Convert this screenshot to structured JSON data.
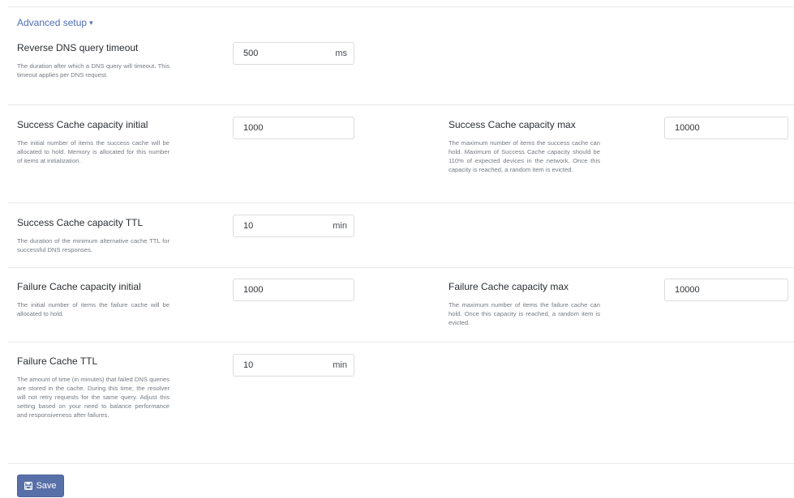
{
  "advanced_toggle": {
    "label": "Advanced setup",
    "caret": "▾"
  },
  "fields": {
    "reverse_dns_timeout": {
      "label": "Reverse DNS query timeout",
      "help": "The duration after which a DNS query will timeout. This timeout applies per DNS request.",
      "value": "500",
      "unit": "ms"
    },
    "success_cache_initial": {
      "label": "Success Cache capacity initial",
      "help": "The initial number of items the success cache will be allocated to hold. Memory is allocated for this number of items at initialization.",
      "value": "1000"
    },
    "success_cache_max": {
      "label": "Success Cache capacity max",
      "help": "The maximum number of items the success cache can hold. Maximum of Success Cache capacity should be 110% of expected devices in the network. Once this capacity is reached, a random item is evicted.",
      "value": "10000"
    },
    "success_cache_ttl": {
      "label": "Success Cache capacity TTL",
      "help": "The duration of the minimum alternative cache TTL for successful DNS responses.",
      "value": "10",
      "unit": "min"
    },
    "failure_cache_initial": {
      "label": "Failure Cache capacity initial",
      "help": "The initial number of items the failure cache will be allocated to hold.",
      "value": "1000"
    },
    "failure_cache_max": {
      "label": "Failure Cache capacity max",
      "help": "The maximum number of items the failure cache can hold. Once this capacity is reached, a random item is evicted.",
      "value": "10000"
    },
    "failure_cache_ttl": {
      "label": "Failure Cache TTL",
      "help": "The amount of time (in minutes) that failed DNS queries are stored in the cache. During this time, the resolver will not retry requests for the same query. Adjust this setting based on your need to balance performance and responsiveness after failures.",
      "value": "10",
      "unit": "min"
    }
  },
  "save_button": {
    "label": "Save",
    "icon": "floppy-disk-icon"
  },
  "colors": {
    "accent": "#5870a8",
    "link": "#4f6fb3"
  }
}
